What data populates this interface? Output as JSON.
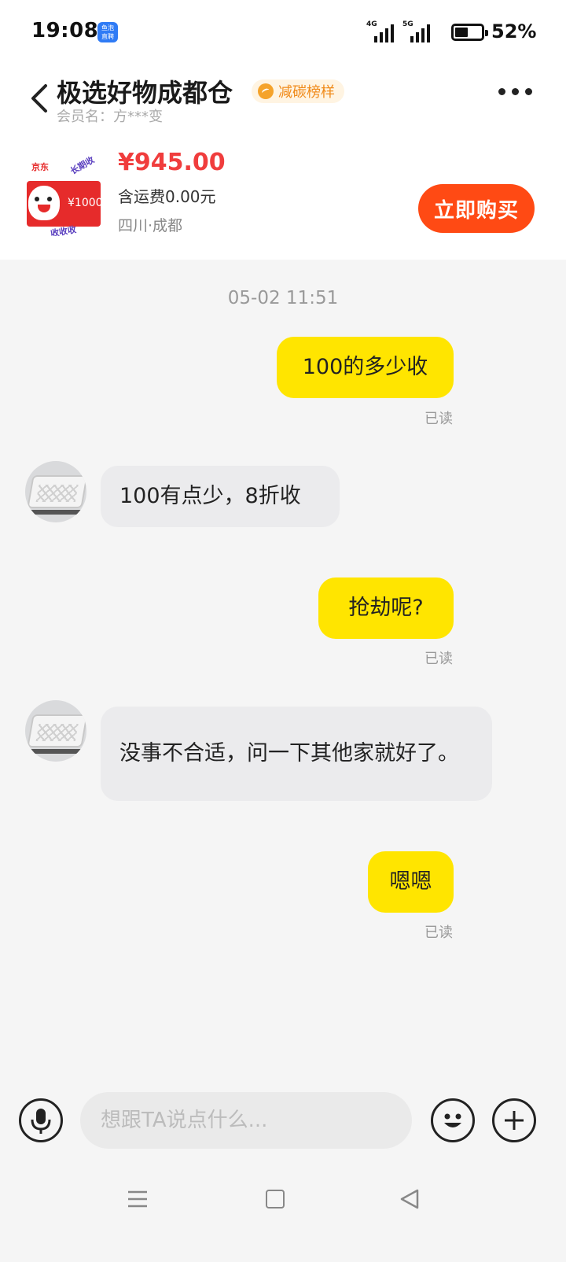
{
  "status_bar": {
    "time": "19:08",
    "app_badge": [
      "鱼泡",
      "直聘"
    ],
    "network_1": "4G",
    "network_2": "5G",
    "battery": "52%"
  },
  "header": {
    "title": "极选好物成都仓",
    "badge": "减碳榜样",
    "member": "会员名：方***变",
    "back_icon": "chevron-left-icon",
    "more_icon": "more-dots-icon"
  },
  "product": {
    "image_brand": "京东",
    "image_card_value": "¥1000",
    "image_stamp_top": "长期收",
    "image_stamp_bottom": "收收收",
    "price": "¥945.00",
    "shipping": "含运费0.00元",
    "location": "四川·成都",
    "buy_label": "立即购买"
  },
  "chat": {
    "timestamp": "05-02 11:51",
    "messages": [
      {
        "from": "me",
        "text": "100的多少收",
        "status": "已读"
      },
      {
        "from": "other",
        "text": "100有点少，8折收"
      },
      {
        "from": "me",
        "text": "抢劫呢?",
        "status": "已读"
      },
      {
        "from": "other",
        "text": "没事不合适，问一下其他家就好了。"
      },
      {
        "from": "me",
        "text": "嗯嗯",
        "status": "已读"
      }
    ]
  },
  "composer": {
    "placeholder": "想跟TA说点什么...",
    "value": "",
    "mic_icon": "microphone-icon",
    "emoji_icon": "emoji-icon",
    "plus_icon": "plus-icon"
  },
  "colors": {
    "my_bubble": "#ffe500",
    "other_bubble": "#ebebed",
    "price": "#f03d3d",
    "buy_button": "#ff4a14",
    "eco_badge": "#f08a19"
  }
}
